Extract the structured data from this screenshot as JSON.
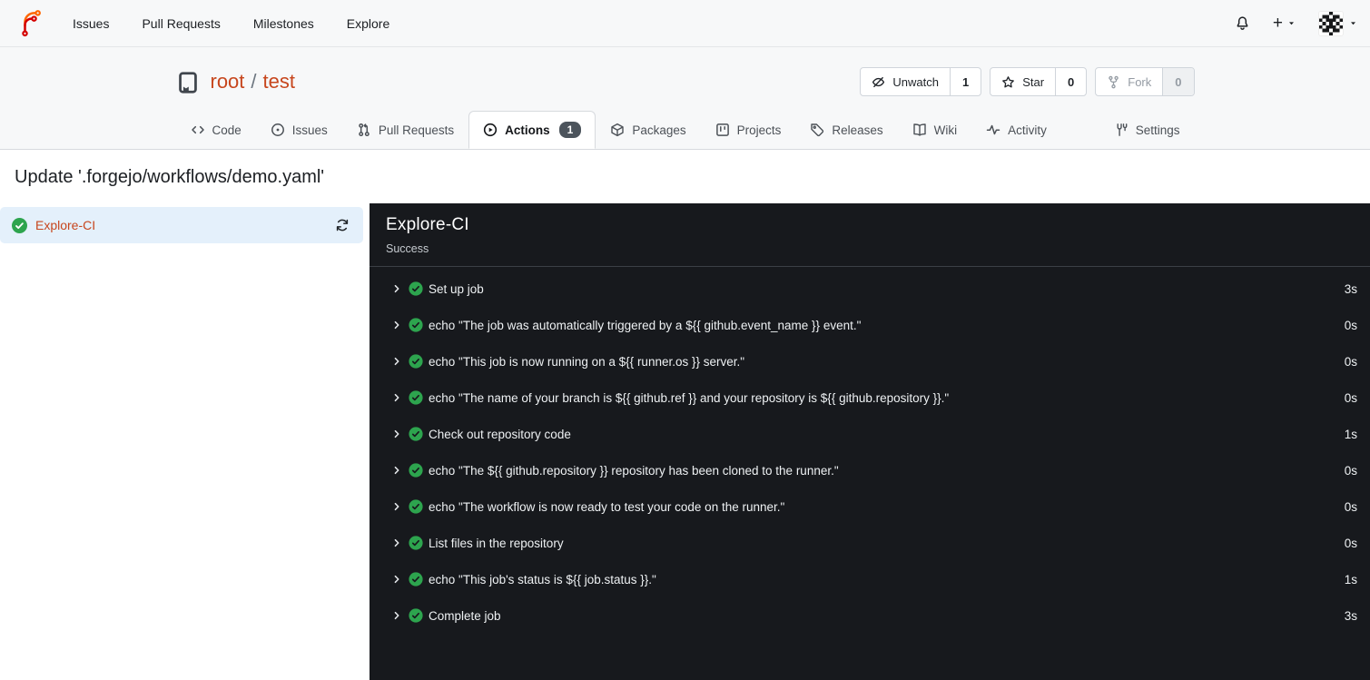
{
  "navbar": {
    "links": [
      "Issues",
      "Pull Requests",
      "Milestones",
      "Explore"
    ],
    "plus_label": "+"
  },
  "repo": {
    "owner": "root",
    "separator": "/",
    "name": "test",
    "buttons": [
      {
        "label": "Unwatch",
        "count": "1"
      },
      {
        "label": "Star",
        "count": "0"
      },
      {
        "label": "Fork",
        "count": "0",
        "disabled": true
      }
    ]
  },
  "tabs": [
    {
      "label": "Code"
    },
    {
      "label": "Issues"
    },
    {
      "label": "Pull Requests"
    },
    {
      "label": "Actions",
      "badge": "1",
      "active": true
    },
    {
      "label": "Packages"
    },
    {
      "label": "Projects"
    },
    {
      "label": "Releases"
    },
    {
      "label": "Wiki"
    },
    {
      "label": "Activity"
    },
    {
      "label": "Settings"
    }
  ],
  "run": {
    "title": "Update '.forgejo/workflows/demo.yaml'",
    "job_name": "Explore-CI"
  },
  "panel": {
    "title": "Explore-CI",
    "status": "Success",
    "steps": [
      {
        "name": "Set up job",
        "duration": "3s"
      },
      {
        "name": "echo \"The job was automatically triggered by a ${{ github.event_name }} event.\"",
        "duration": "0s"
      },
      {
        "name": "echo \"This job is now running on a ${{ runner.os }} server.\"",
        "duration": "0s"
      },
      {
        "name": "echo \"The name of your branch is ${{ github.ref }} and your repository is ${{ github.repository }}.\"",
        "duration": "0s"
      },
      {
        "name": "Check out repository code",
        "duration": "1s"
      },
      {
        "name": "echo \"The ${{ github.repository }} repository has been cloned to the runner.\"",
        "duration": "0s"
      },
      {
        "name": "echo \"The workflow is now ready to test your code on the runner.\"",
        "duration": "0s"
      },
      {
        "name": "List files in the repository",
        "duration": "0s"
      },
      {
        "name": "echo \"This job's status is ${{ job.status }}.\"",
        "duration": "1s"
      },
      {
        "name": "Complete job",
        "duration": "3s"
      }
    ]
  },
  "colors": {
    "primary_link": "#c7461d",
    "success_green": "#2da44e",
    "console_background": "#17191d",
    "selected_job_background": "#e4f0fb",
    "tab_badge_background": "#4c545c",
    "header_background": "#f7f8f9"
  }
}
